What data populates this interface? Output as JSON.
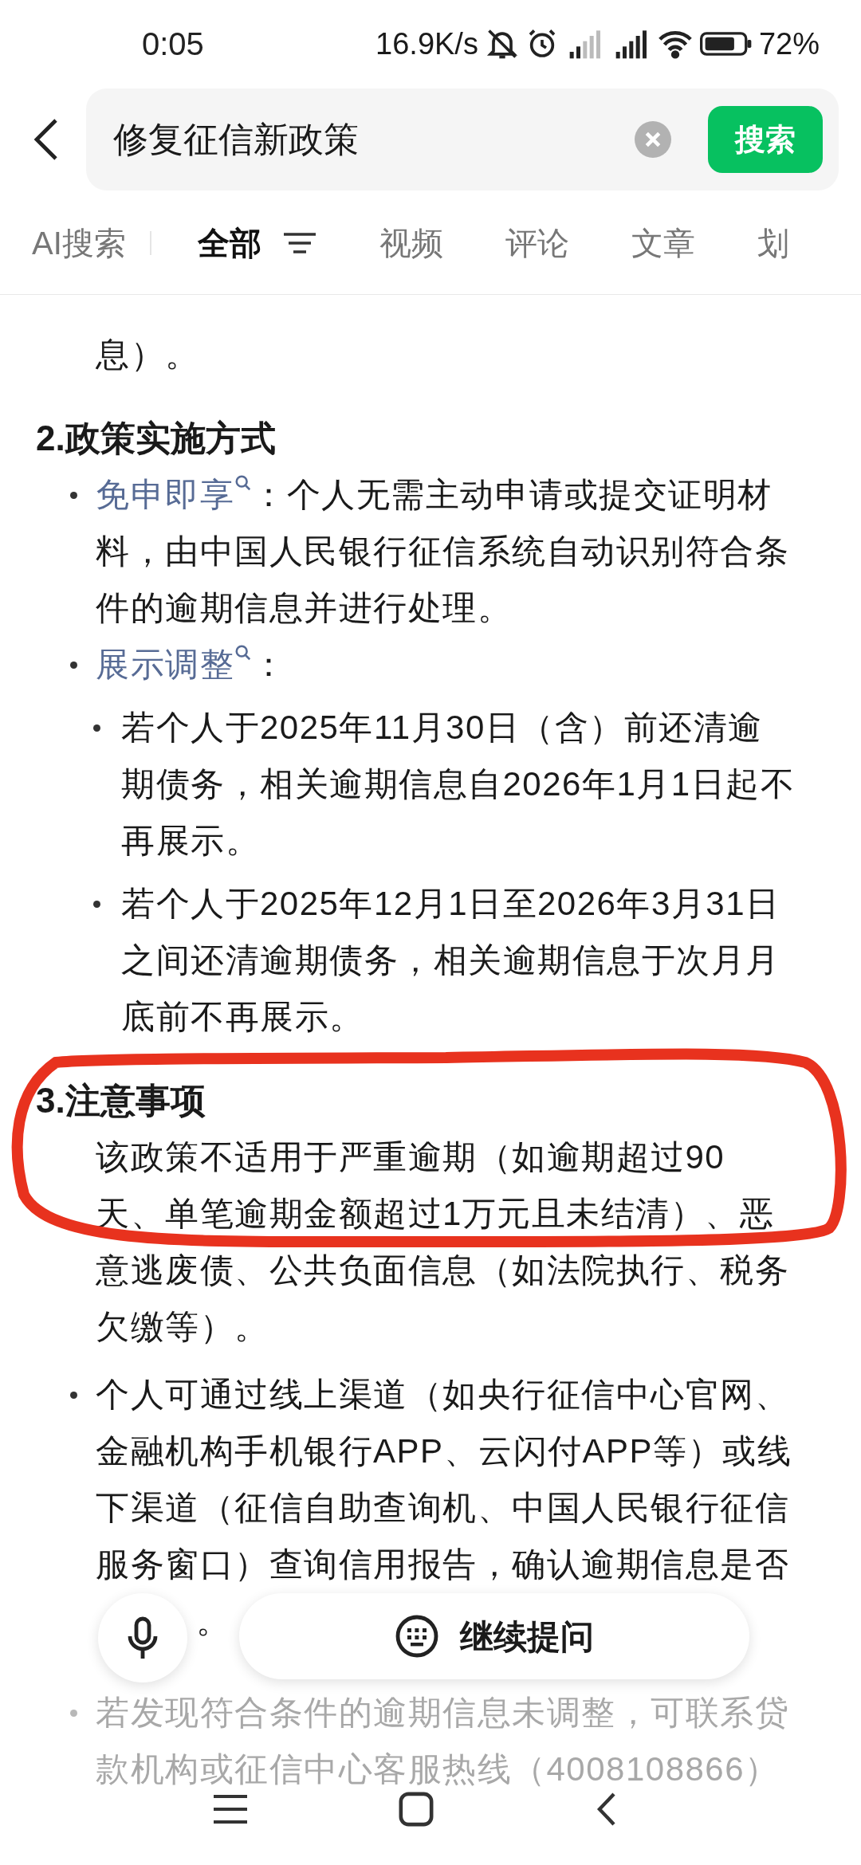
{
  "status_bar": {
    "time": "0:05",
    "net_speed": "16.9K/s",
    "battery": "72%"
  },
  "search": {
    "query": "修复征信新政策",
    "button": "搜索"
  },
  "tabs": [
    {
      "label": "AI搜索",
      "selected": false
    },
    {
      "label": "全部",
      "selected": true
    },
    {
      "label": "视频",
      "selected": false
    },
    {
      "label": "评论",
      "selected": false
    },
    {
      "label": "文章",
      "selected": false
    },
    {
      "label": "划",
      "selected": false
    }
  ],
  "content": [
    {
      "kind": "paragraph",
      "text": "息）。"
    },
    {
      "kind": "heading",
      "number": "2.",
      "text": "政策实施方式"
    },
    {
      "kind": "bullet",
      "link": "免申即享",
      "text": "：个人无需主动申请或提交证明材料，由中国人民银行征信系统自动识别符合条件的逾期信息并进行处理。"
    },
    {
      "kind": "bullet",
      "link": "展示调整",
      "text": "：",
      "children": [
        {
          "text": "若个人于2025年11月30日（含）前还清逾期债务，相关逾期信息自2026年1月1日起不再展示。"
        },
        {
          "text": "若个人于2025年12月1日至2026年3月31日之间还清逾期债务，相关逾期信息于次月月底前不再展示。"
        }
      ]
    },
    {
      "kind": "heading",
      "number": "3.",
      "text": "注意事项"
    },
    {
      "kind": "paragraph",
      "text": "该政策不适用于严重逾期（如逾期超过90天、单笔逾期金额超过1万元且未结清）、恶意逃废债、公共负面信息（如法院执行、税务欠缴等）。"
    },
    {
      "kind": "bullet",
      "text": "个人可通过线上渠道（如央行征信中心官网、金融机构手机银行APP、云闪付APP等）或线下渠道（征信自助查询机、中国人民银行征信服务窗口）查询信用报告，确认逾期信息是否",
      "tail": "。"
    },
    {
      "kind": "bullet",
      "faded": true,
      "text": "若发现符合条件的逾期信息未调整，可联系贷款机构或征信中心客服热线（4008108866）"
    }
  ],
  "ask_button": "继续提问"
}
